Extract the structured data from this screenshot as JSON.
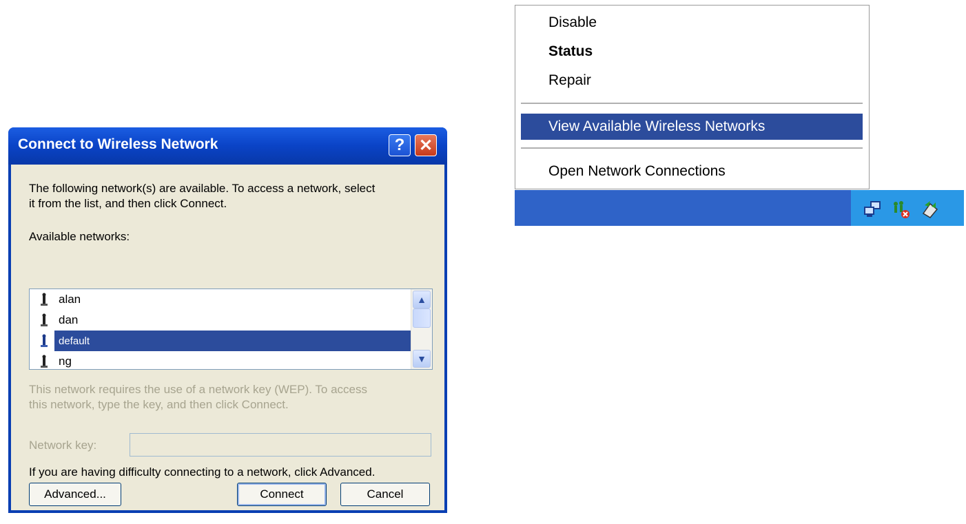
{
  "dialog": {
    "title": "Connect to Wireless Network",
    "help_button": "?",
    "close_button": "✕",
    "intro_line1": "The following network(s) are available. To access a network, select",
    "intro_line2": "it from the list, and then click Connect.",
    "available_label": "Available networks:",
    "networks": [
      "alan",
      "dan",
      "default",
      "ng"
    ],
    "selected_network": "default",
    "wep_line1": "This network requires the use of a network key (WEP). To access",
    "wep_line2": "this network, type the key, and then click Connect.",
    "key_label": "Network key:",
    "key_value": "",
    "difficulty_text": "If you are having difficulty connecting to a network, click Advanced.",
    "advanced_label": "Advanced...",
    "connect_label": "Connect",
    "cancel_label": "Cancel"
  },
  "context_menu": {
    "items": [
      "Disable",
      "Status",
      "Repair",
      "View Available Wireless Networks",
      "Open Network Connections"
    ],
    "bold_item": "Status",
    "highlighted_item": "View Available Wireless Networks"
  },
  "tray": {
    "icons": [
      "network-connection-icon",
      "wireless-disconnected-icon",
      "safely-remove-hardware-icon"
    ]
  },
  "colors": {
    "title_bar": "#0a43c6",
    "selection": "#2c4c9c",
    "dialog_face": "#ece9d8",
    "taskbar": "#2f63c8",
    "tray": "#2a98e6"
  }
}
